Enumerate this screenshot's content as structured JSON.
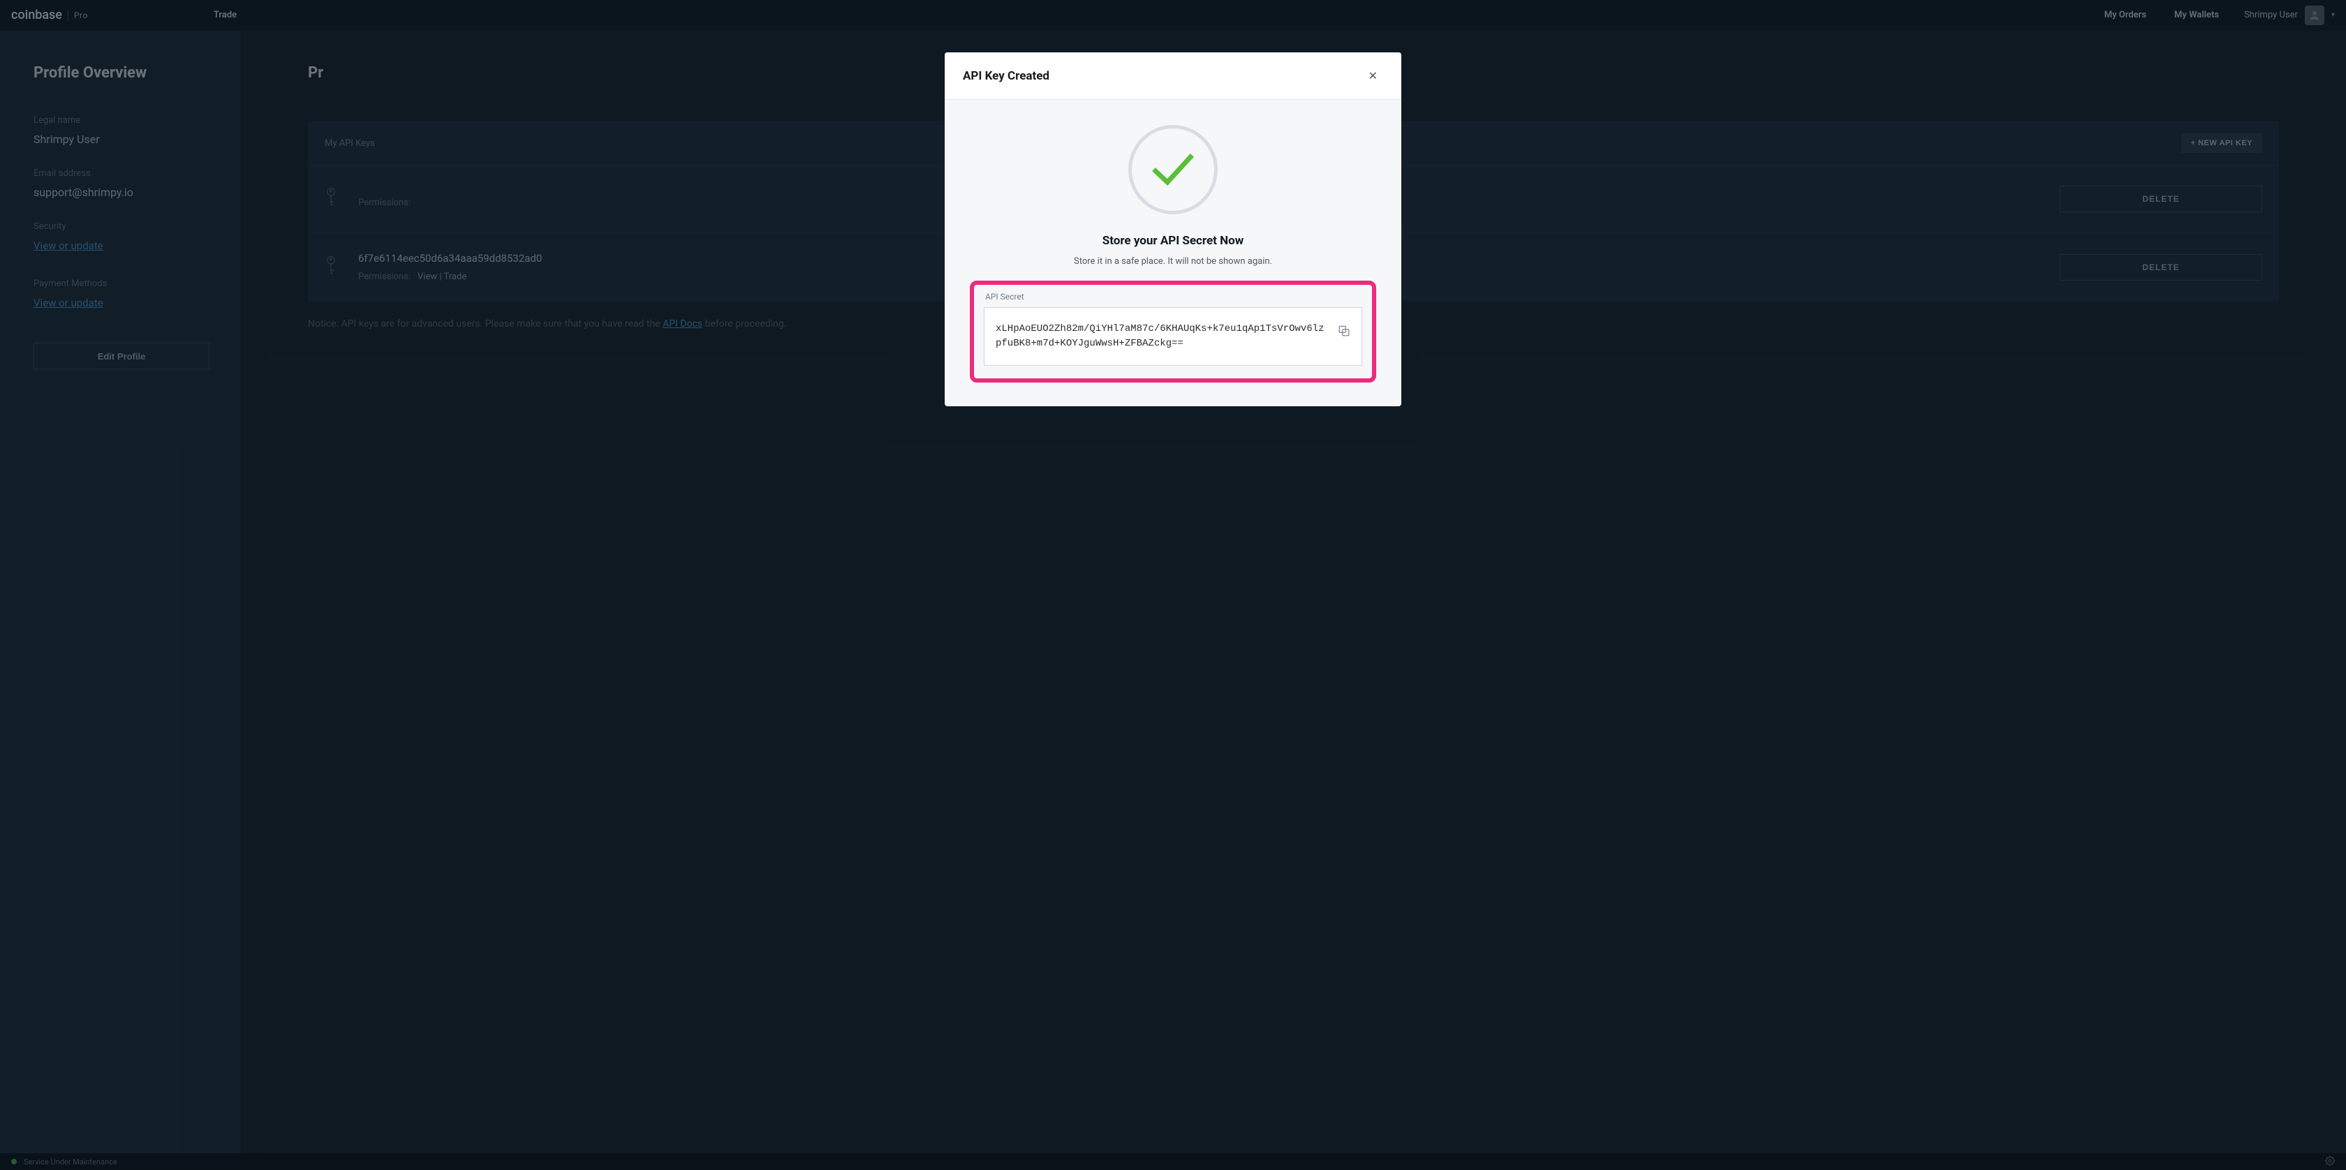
{
  "brand": {
    "main": "coinbase",
    "sub": "Pro"
  },
  "nav": {
    "trade": "Trade",
    "orders": "My Orders",
    "wallets": "My Wallets",
    "user": "Shrimpy User"
  },
  "sidebar": {
    "title": "Profile Overview",
    "legal_label": "Legal name",
    "legal_value": "Shrimpy User",
    "email_label": "Email address",
    "email_value": "support@shrimpy.io",
    "security_label": "Security",
    "security_link": "View or update",
    "payment_label": "Payment Methods",
    "payment_link": "View or update",
    "edit_btn": "Edit Profile"
  },
  "main": {
    "title_prefix": "Pr",
    "api_header": "My API Keys",
    "new_api_btn": "+ NEW API KEY",
    "delete_btn": "DELETE",
    "perm_label": "Permissions:",
    "keys": [
      {
        "value": "",
        "perms": ""
      },
      {
        "value": "6f7e6114eec50d6a34aaa59dd8532ad0",
        "perms": "View | Trade"
      }
    ],
    "notice_pre": "Notice: API keys are for advanced users. Please make sure that you have read the ",
    "notice_link": "API Docs",
    "notice_post": " before proceeding."
  },
  "modal": {
    "title": "API Key Created",
    "sub": "Store your API Secret Now",
    "hint": "Store it in a safe place. It will not be shown again.",
    "secret_label": "API Secret",
    "secret_value": "xLHpAoEUO2Zh82m/QiYHl7aM87c/6KHAUqKs+k7eu1qAp1TsVrOwv6lzpfuBK8+m7d+KOYJguWwsH+ZFBAZckg=="
  },
  "status": {
    "text": "Service Under Maintenance"
  }
}
